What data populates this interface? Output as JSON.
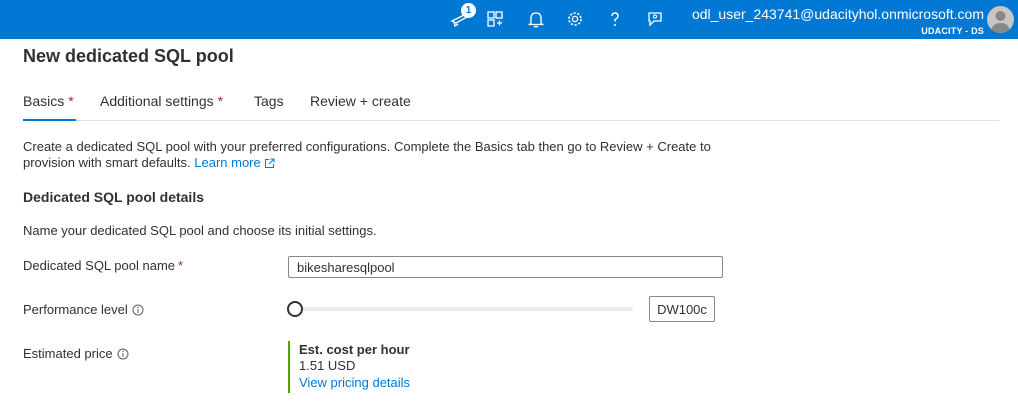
{
  "topbar": {
    "notification_count": "1",
    "user_email": "odl_user_243741@udacityhol.onmicrosoft.com",
    "directory": "UDACITY - DS",
    "icons": [
      "notifications-icon",
      "directories-icon",
      "bell-icon",
      "settings-icon",
      "help-icon",
      "feedback-icon"
    ]
  },
  "page": {
    "title": "New dedicated SQL pool"
  },
  "tabs": [
    {
      "label": "Basics",
      "required": "*"
    },
    {
      "label": "Additional settings",
      "required": "*"
    },
    {
      "label": "Tags"
    },
    {
      "label": "Review + create"
    }
  ],
  "intro": {
    "text": "Create a dedicated SQL pool with your preferred configurations. Complete the Basics tab then go to Review + Create to provision with smart defaults.",
    "link": "Learn more"
  },
  "section": {
    "heading": "Dedicated SQL pool details",
    "description": "Name your dedicated SQL pool and choose its initial settings."
  },
  "fields": {
    "pool_name": {
      "label": "Dedicated SQL pool name",
      "required": "*",
      "value": "bikesharesqlpool"
    },
    "performance": {
      "label": "Performance level",
      "value": "DW100c",
      "slider_fraction": 0
    },
    "price": {
      "label": "Estimated price",
      "title": "Est. cost per hour",
      "value": "1.51 USD",
      "link": "View pricing details"
    }
  },
  "colors": {
    "brand": "#0078d4",
    "required": "#a4262c",
    "price_accent": "#57a300"
  }
}
